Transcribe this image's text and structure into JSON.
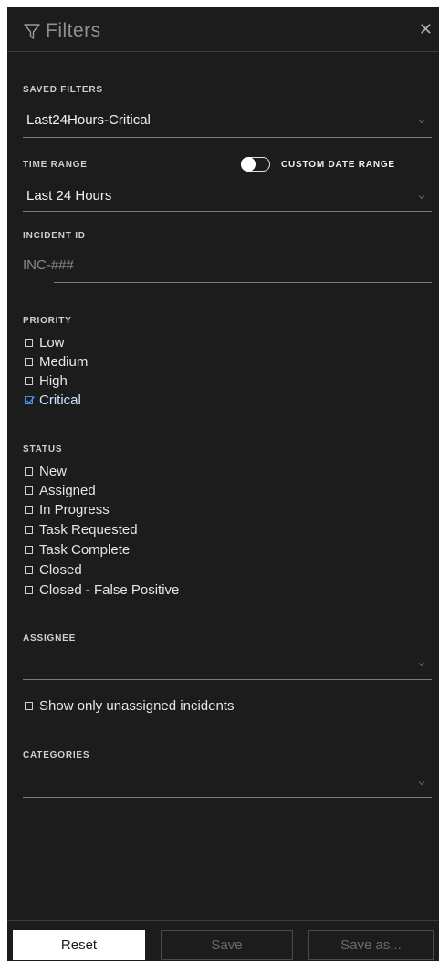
{
  "header": {
    "title": "Filters",
    "close_icon": "close-icon",
    "filter_icon": "filter-funnel-icon"
  },
  "saved_filters": {
    "label": "SAVED FILTERS",
    "value": "Last24Hours-Critical"
  },
  "time_range": {
    "label": "TIME RANGE",
    "toggle_label": "CUSTOM DATE RANGE",
    "toggle_on": false,
    "value": "Last 24 Hours"
  },
  "incident_id": {
    "label": "INCIDENT ID",
    "placeholder": "INC-###"
  },
  "priority": {
    "label": "PRIORITY",
    "options": [
      {
        "label": "Low",
        "checked": false
      },
      {
        "label": "Medium",
        "checked": false
      },
      {
        "label": "High",
        "checked": false
      },
      {
        "label": "Critical",
        "checked": true
      }
    ]
  },
  "status": {
    "label": "STATUS",
    "options": [
      {
        "label": "New",
        "checked": false
      },
      {
        "label": "Assigned",
        "checked": false
      },
      {
        "label": "In Progress",
        "checked": false
      },
      {
        "label": "Task Requested",
        "checked": false
      },
      {
        "label": "Task Complete",
        "checked": false
      },
      {
        "label": "Closed",
        "checked": false
      },
      {
        "label": "Closed - False Positive",
        "checked": false
      }
    ]
  },
  "assignee": {
    "label": "ASSIGNEE",
    "value": "",
    "unassigned_only_label": "Show only unassigned incidents",
    "unassigned_only": false
  },
  "categories": {
    "label": "CATEGORIES",
    "value": ""
  },
  "footer": {
    "reset_label": "Reset",
    "save_label": "Save",
    "save_as_label": "Save as..."
  },
  "colors": {
    "panel_bg": "#1c1c1c",
    "accent_checked": "#4a8ff0"
  }
}
